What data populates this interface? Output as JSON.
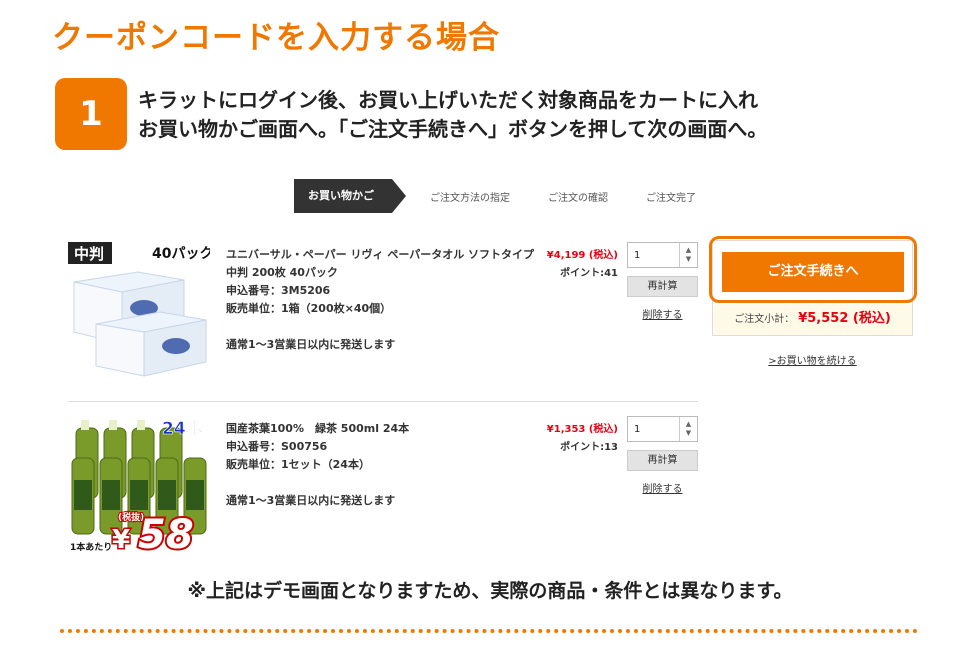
{
  "heading": "クーポンコードを入力する場合",
  "step": {
    "number": "1",
    "line1": "キラットにログイン後、お買い上げいただく対象商品をカートに入れ",
    "line2": "お買い物かご画面へ。「ご注文手続きへ」ボタンを押して次の画面へ。"
  },
  "progress": {
    "steps": [
      "お買い物かご",
      "ご注文方法の指定",
      "ご注文の確認",
      "ご注文完了"
    ]
  },
  "items": [
    {
      "image": {
        "badge": "中判",
        "pack": "40パック"
      },
      "name": "ユニバーサル・ペーパー リヴィ ペーパータオル ソフトタイプ 中判 200枚 40パック",
      "code": "申込番号：3M5206",
      "unit": "販売単位：1箱（200枚×40個）",
      "ship": "通常1～3営業日以内に発送します",
      "price": "¥4,199 (税込)",
      "points": "ポイント:41",
      "qty": "1",
      "recalc": "再計算",
      "delete": "削除する"
    },
    {
      "image": {
        "count": "24本",
        "tax": "(税抜)",
        "per": "1本あたり",
        "yen": "¥",
        "price": "58"
      },
      "name": "国産茶葉100%　緑茶 500ml 24本",
      "code": "申込番号：S00756",
      "unit": "販売単位：1セット（24本）",
      "ship": "通常1～3営業日以内に発送します",
      "price": "¥1,353 (税込)",
      "points": "ポイント:13",
      "qty": "1",
      "recalc": "再計算",
      "delete": "削除する"
    }
  ],
  "checkout": {
    "button": "ご注文手続きへ",
    "subtotal_label": "ご注文小計：",
    "subtotal_value": "¥5,552 (税込)",
    "continue": ">お買い物を続ける"
  },
  "note": "※上記はデモ画面となりますため、実際の商品・条件とは異なります。",
  "colors": {
    "accent": "#f07800",
    "price_red": "#e60012"
  }
}
